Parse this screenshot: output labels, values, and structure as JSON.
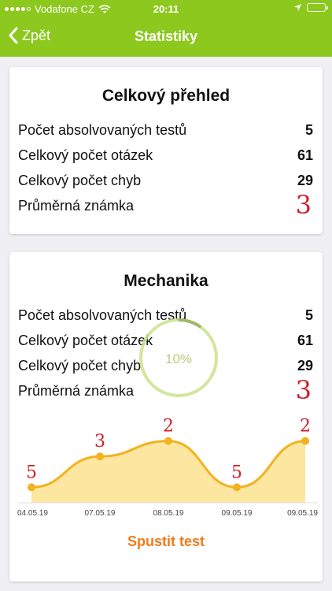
{
  "status_bar": {
    "carrier": "Vodafone CZ",
    "time": "20:11"
  },
  "nav": {
    "back_label": "Zpět",
    "title": "Statistiky"
  },
  "overview": {
    "title": "Celkový přehled",
    "rows": [
      {
        "label": "Počet absolvovaných testů",
        "value": "5"
      },
      {
        "label": "Celkový počet otázek",
        "value": "61"
      },
      {
        "label": "Celkový počet chyb",
        "value": "29"
      },
      {
        "label": "Průměrná známka",
        "value": "3"
      }
    ]
  },
  "mechanika": {
    "title": "Mechanika",
    "rows": [
      {
        "label": "Počet absolvovaných testů",
        "value": "5"
      },
      {
        "label": "Celkový počet otázek",
        "value": "61"
      },
      {
        "label": "Celkový počet chyb",
        "value": "29"
      },
      {
        "label": "Průměrná známka",
        "value": "3"
      }
    ],
    "progress_label": "10%",
    "progress_fraction": 0.1,
    "start_button": "Spustit test"
  },
  "colors": {
    "brand_green": "#8dc81e",
    "chart_line": "#f2b21f",
    "chart_fill": "#fde6a0",
    "grade_red": "#d0202a",
    "button_orange": "#f07a1a",
    "progress_ring": "#c9e38c"
  },
  "chart_data": {
    "type": "area",
    "x": [
      "04.05.19",
      "07.05.19",
      "08.05.19",
      "09.05.19",
      "09.05.19"
    ],
    "x_tick_labels": [
      "04.05.19",
      "07.05.19",
      "08.05.19",
      "09.05.19",
      "09.05.19"
    ],
    "values": [
      5,
      3,
      2,
      5,
      2
    ],
    "point_labels": [
      "5",
      "3",
      "2",
      "5",
      "2"
    ],
    "ylim": [
      1,
      6
    ],
    "y_inverted": true,
    "grid": false,
    "title": "",
    "xlabel": "",
    "ylabel": ""
  }
}
